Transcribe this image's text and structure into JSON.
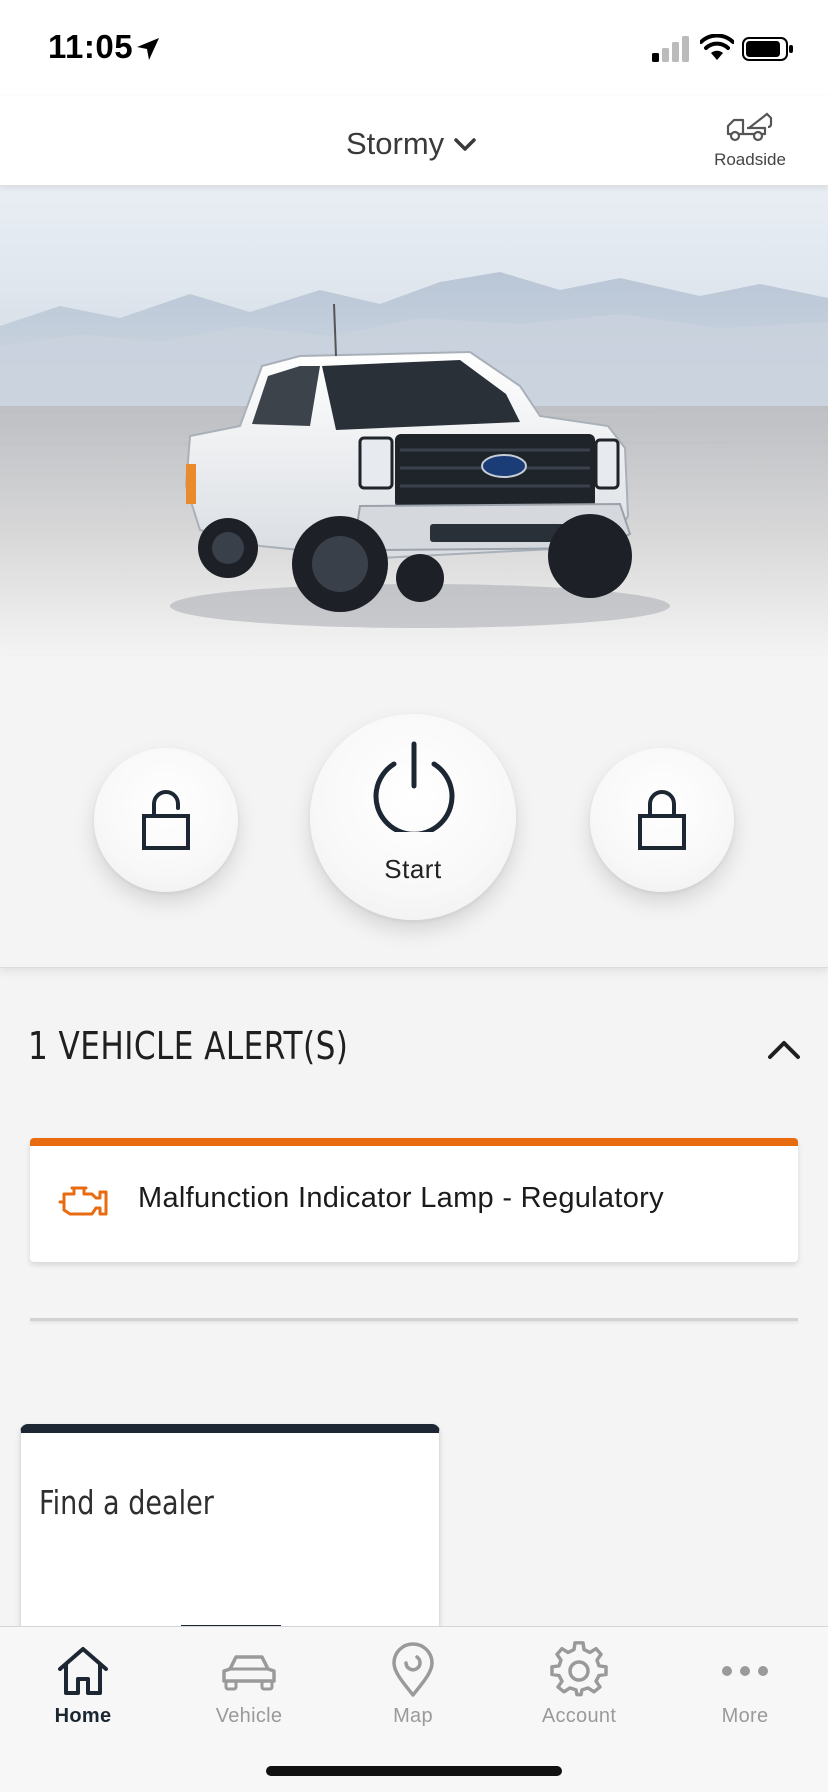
{
  "status_bar": {
    "time": "11:05"
  },
  "header": {
    "vehicle_name": "Stormy",
    "roadside_label": "Roadside"
  },
  "controls": {
    "start_label": "Start"
  },
  "alerts": {
    "title": "1 VEHICLE ALERT(S)",
    "items": [
      {
        "text": "Malfunction Indicator Lamp - Regulatory",
        "icon": "engine-icon",
        "color": "#e96b10"
      }
    ]
  },
  "dealer": {
    "title": "Find a dealer"
  },
  "tab_bar": {
    "items": [
      {
        "label": "Home",
        "icon": "home-icon",
        "active": true
      },
      {
        "label": "Vehicle",
        "icon": "car-icon",
        "active": false
      },
      {
        "label": "Map",
        "icon": "map-pin-icon",
        "active": false
      },
      {
        "label": "Account",
        "icon": "gear-icon",
        "active": false
      },
      {
        "label": "More",
        "icon": "more-icon",
        "active": false
      }
    ]
  },
  "colors": {
    "accent_alert": "#e96b10",
    "brand_dark": "#1c2733",
    "inactive_tab": "#9a9a9a"
  }
}
